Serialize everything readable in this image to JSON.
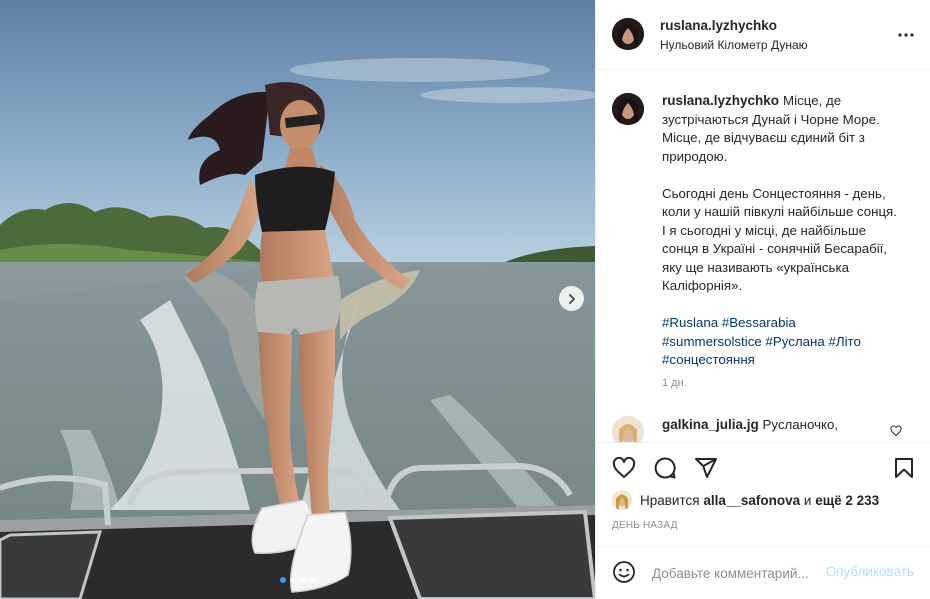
{
  "post": {
    "author": "ruslana.lyzhychko",
    "location": "Нульовий Кілометр Дунаю",
    "caption_lines_1": "Місце, де зустрічаються Дунай і Чорне Море. Місце, де відчуваєш єдиний біт з природою.",
    "caption_para_2": "Сьогодні день Сонцестояння - день, коли у нашій півкулі найбільше сонця. І я сьогодні у місці, де найбільше сонця в Україні - сонячній Бесарабії, яку ще називають «українська Каліфорнія».",
    "hashtags": [
      "#Ruslana",
      "#Bessarabia",
      "#summersolstice",
      "#Руслана",
      "#Літо",
      "#сонцестояння"
    ],
    "time_ago": "1 дн."
  },
  "comment": {
    "author": "galkina_julia.jg",
    "text": "Русланочко,"
  },
  "likes": {
    "prefix": "Нравится",
    "user": "alla__safonova",
    "connector": "и",
    "others": "ещё 2 233"
  },
  "date_label": "ДЕНЬ НАЗАД",
  "add_comment": {
    "placeholder": "Добавьте комментарий...",
    "publish_label": "Опубликовать"
  },
  "carousel": {
    "slides": 4,
    "active_index": 0
  },
  "icons": {
    "more": "more-horizontal-icon",
    "heart": "heart-icon",
    "comment": "comment-icon",
    "share": "send-icon",
    "save": "bookmark-icon",
    "emoji": "emoji-icon",
    "next": "chevron-right-icon"
  },
  "colors": {
    "link": "#00376b",
    "muted": "#8e8e8e",
    "publish_disabled": "#b2dffc",
    "carousel_active": "#3897f0"
  }
}
